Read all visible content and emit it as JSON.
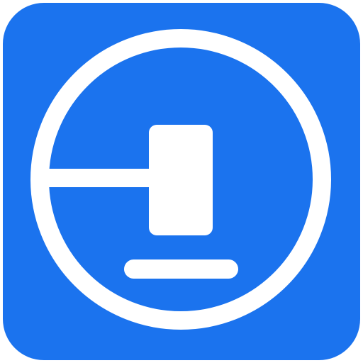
{
  "icon": {
    "name": "gavel-icon",
    "colors": {
      "background": "#1B73EE",
      "foreground": "#FFFFFF"
    }
  }
}
